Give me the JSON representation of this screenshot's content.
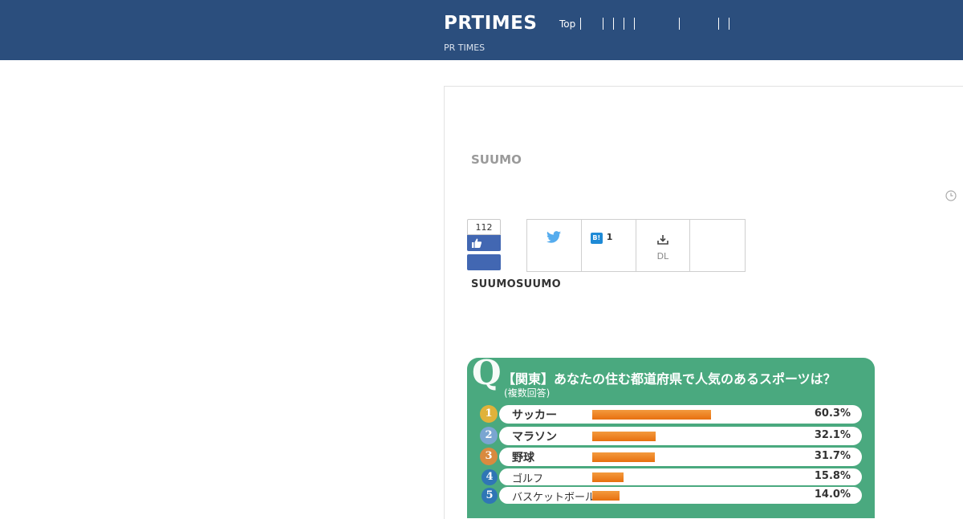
{
  "header": {
    "logo": "PRTIMES",
    "nav_first": "Top",
    "sublabel": "PR TIMES"
  },
  "article": {
    "company": "SUUMO",
    "source": "SUUMOSUUMO"
  },
  "social": {
    "like_count": "112",
    "hatena_label": "B!",
    "hatena_count": "1",
    "download_label": "DL"
  },
  "infographic": {
    "q_mark": "Q",
    "title": "【関東】あなたの住む都道府県で人気のあるスポーツは？",
    "subtitle": "(複数回答)",
    "items": [
      {
        "rank": "1",
        "label": "サッカー",
        "value": 60.3,
        "pct": "60.3%"
      },
      {
        "rank": "2",
        "label": "マラソン",
        "value": 32.1,
        "pct": "32.1%"
      },
      {
        "rank": "3",
        "label": "野球",
        "value": 31.7,
        "pct": "31.7%"
      },
      {
        "rank": "4",
        "label": "ゴルフ",
        "value": 15.8,
        "pct": "15.8%"
      },
      {
        "rank": "5",
        "label": "バスケットボール",
        "value": 14.0,
        "pct": "14.0%"
      }
    ]
  },
  "colors": {
    "header_bg": "#2b4e7d",
    "facebook_blue": "#4267b2",
    "infographic_green": "#4aa97f",
    "bar_orange": "#f07814"
  }
}
